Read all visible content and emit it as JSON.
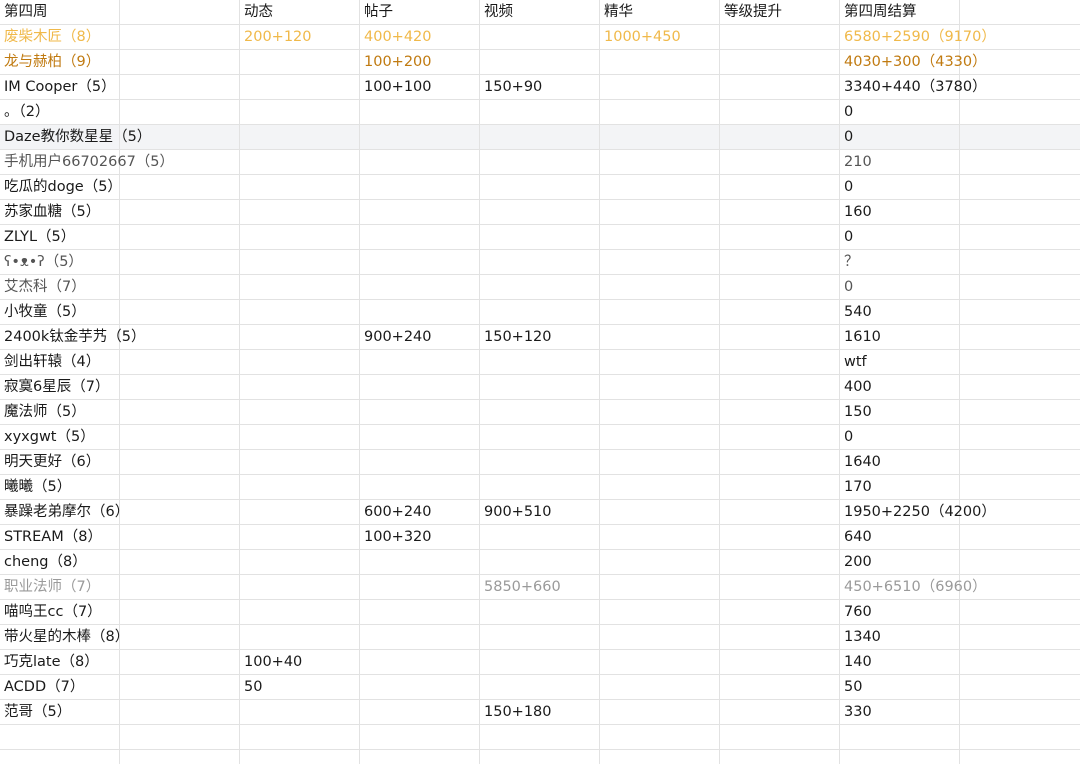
{
  "colors": {
    "orange_light": "#f0b94a",
    "orange_dark": "#c07a10",
    "gray": "#9a9a9a",
    "dark_gray": "#555555",
    "default": "#1a1a1a",
    "highlight_row_bg": "#f3f4f6",
    "grid_line": "#e2e2e2"
  },
  "header": [
    "第四周",
    "动态",
    "帖子",
    "视频",
    "精华",
    "等级提升",
    "第四周结算",
    "",
    ""
  ],
  "rows": [
    {
      "style": "orange_light",
      "highlight": false,
      "cells": [
        "废柴木匠（8）",
        "200+120",
        "400+420",
        "",
        "1000+450",
        "",
        "6580+2590（9170）",
        "",
        ""
      ]
    },
    {
      "style": "orange_dark",
      "highlight": false,
      "cells": [
        "龙与赫柏（9）",
        "",
        "100+200",
        "",
        "",
        "",
        "4030+300（4330）",
        "",
        ""
      ]
    },
    {
      "style": "default",
      "highlight": false,
      "cells": [
        "IM Cooper（5）",
        "",
        "100+100",
        "150+90",
        "",
        "",
        "3340+440（3780）",
        "",
        ""
      ]
    },
    {
      "style": "default",
      "highlight": false,
      "cells": [
        "。（2）",
        "",
        "",
        "",
        "",
        "",
        "0",
        "",
        ""
      ]
    },
    {
      "style": "default",
      "highlight": true,
      "cells": [
        "Daze教你数星星（5）",
        "",
        "",
        "",
        "",
        "",
        "0",
        "",
        ""
      ]
    },
    {
      "style": "dark_gray",
      "highlight": false,
      "cells": [
        "手机用户66702667（5）",
        "",
        "",
        "",
        "",
        "",
        "210",
        "",
        ""
      ]
    },
    {
      "style": "default",
      "highlight": false,
      "cells": [
        "吃瓜的doge（5）",
        "",
        "",
        "",
        "",
        "",
        "0",
        "",
        ""
      ]
    },
    {
      "style": "default",
      "highlight": false,
      "cells": [
        "苏家血糖（5）",
        "",
        "",
        "",
        "",
        "",
        "160",
        "",
        ""
      ]
    },
    {
      "style": "default",
      "highlight": false,
      "cells": [
        "ZLYL（5）",
        "",
        "",
        "",
        "",
        "",
        "0",
        "",
        ""
      ]
    },
    {
      "style": "dark_gray",
      "highlight": false,
      "cells": [
        "ʕ•ᴥ•ʔ（5）",
        "",
        "",
        "",
        "",
        "",
        "？",
        "",
        ""
      ]
    },
    {
      "style": "dark_gray",
      "highlight": false,
      "cells": [
        "艾杰科（7）",
        "",
        "",
        "",
        "",
        "",
        "0",
        "",
        ""
      ]
    },
    {
      "style": "default",
      "highlight": false,
      "cells": [
        "小牧童（5）",
        "",
        "",
        "",
        "",
        "",
        "540",
        "",
        ""
      ]
    },
    {
      "style": "default",
      "highlight": false,
      "cells": [
        "2400k钛金芋艿（5）",
        "",
        "900+240",
        "150+120",
        "",
        "",
        "1610",
        "",
        ""
      ]
    },
    {
      "style": "default",
      "highlight": false,
      "cells": [
        "剑出轩辕（4）",
        "",
        "",
        "",
        "",
        "",
        "wtf",
        "",
        ""
      ]
    },
    {
      "style": "default",
      "highlight": false,
      "cells": [
        "寂寞6星辰（7）",
        "",
        "",
        "",
        "",
        "",
        "400",
        "",
        ""
      ]
    },
    {
      "style": "default",
      "highlight": false,
      "cells": [
        "魔法师（5）",
        "",
        "",
        "",
        "",
        "",
        "150",
        "",
        ""
      ]
    },
    {
      "style": "default",
      "highlight": false,
      "cells": [
        "xyxgwt（5）",
        "",
        "",
        "",
        "",
        "",
        "0",
        "",
        ""
      ]
    },
    {
      "style": "default",
      "highlight": false,
      "cells": [
        "明天更好（6）",
        "",
        "",
        "",
        "",
        "",
        "1640",
        "",
        ""
      ]
    },
    {
      "style": "default",
      "highlight": false,
      "cells": [
        "曦曦（5）",
        "",
        "",
        "",
        "",
        "",
        "170",
        "",
        ""
      ]
    },
    {
      "style": "default",
      "highlight": false,
      "cells": [
        "暴躁老弟摩尔（6）",
        "",
        "600+240",
        "900+510",
        "",
        "",
        "1950+2250（4200）",
        "",
        ""
      ]
    },
    {
      "style": "default",
      "highlight": false,
      "cells": [
        "STREAM（8）",
        "",
        "100+320",
        "",
        "",
        "",
        "640",
        "",
        ""
      ]
    },
    {
      "style": "default",
      "highlight": false,
      "cells": [
        "cheng（8）",
        "",
        "",
        "",
        "",
        "",
        "200",
        "",
        ""
      ]
    },
    {
      "style": "gray",
      "highlight": false,
      "cells": [
        "职业法师（7）",
        "",
        "",
        "5850+660",
        "",
        "",
        "450+6510（6960）",
        "",
        ""
      ]
    },
    {
      "style": "default",
      "highlight": false,
      "cells": [
        "喵呜王cc（7）",
        "",
        "",
        "",
        "",
        "",
        "760",
        "",
        ""
      ]
    },
    {
      "style": "default",
      "highlight": false,
      "cells": [
        "带火星的木棒（8）",
        "",
        "",
        "",
        "",
        "",
        "1340",
        "",
        ""
      ]
    },
    {
      "style": "default",
      "highlight": false,
      "cells": [
        "巧克late（8）",
        "100+40",
        "",
        "",
        "",
        "",
        "140",
        "",
        ""
      ]
    },
    {
      "style": "default",
      "highlight": false,
      "cells": [
        "ACDD（7）",
        "50",
        "",
        "",
        "",
        "",
        "50",
        "",
        ""
      ]
    },
    {
      "style": "default",
      "highlight": false,
      "cells": [
        "范哥（5）",
        "",
        "",
        "150+180",
        "",
        "",
        "330",
        "",
        ""
      ]
    },
    {
      "style": "default",
      "highlight": false,
      "cells": [
        "",
        "",
        "",
        "",
        "",
        "",
        "",
        "",
        ""
      ]
    },
    {
      "style": "default",
      "highlight": false,
      "cells": [
        "",
        "",
        "",
        "",
        "",
        "",
        "",
        "",
        ""
      ]
    }
  ]
}
